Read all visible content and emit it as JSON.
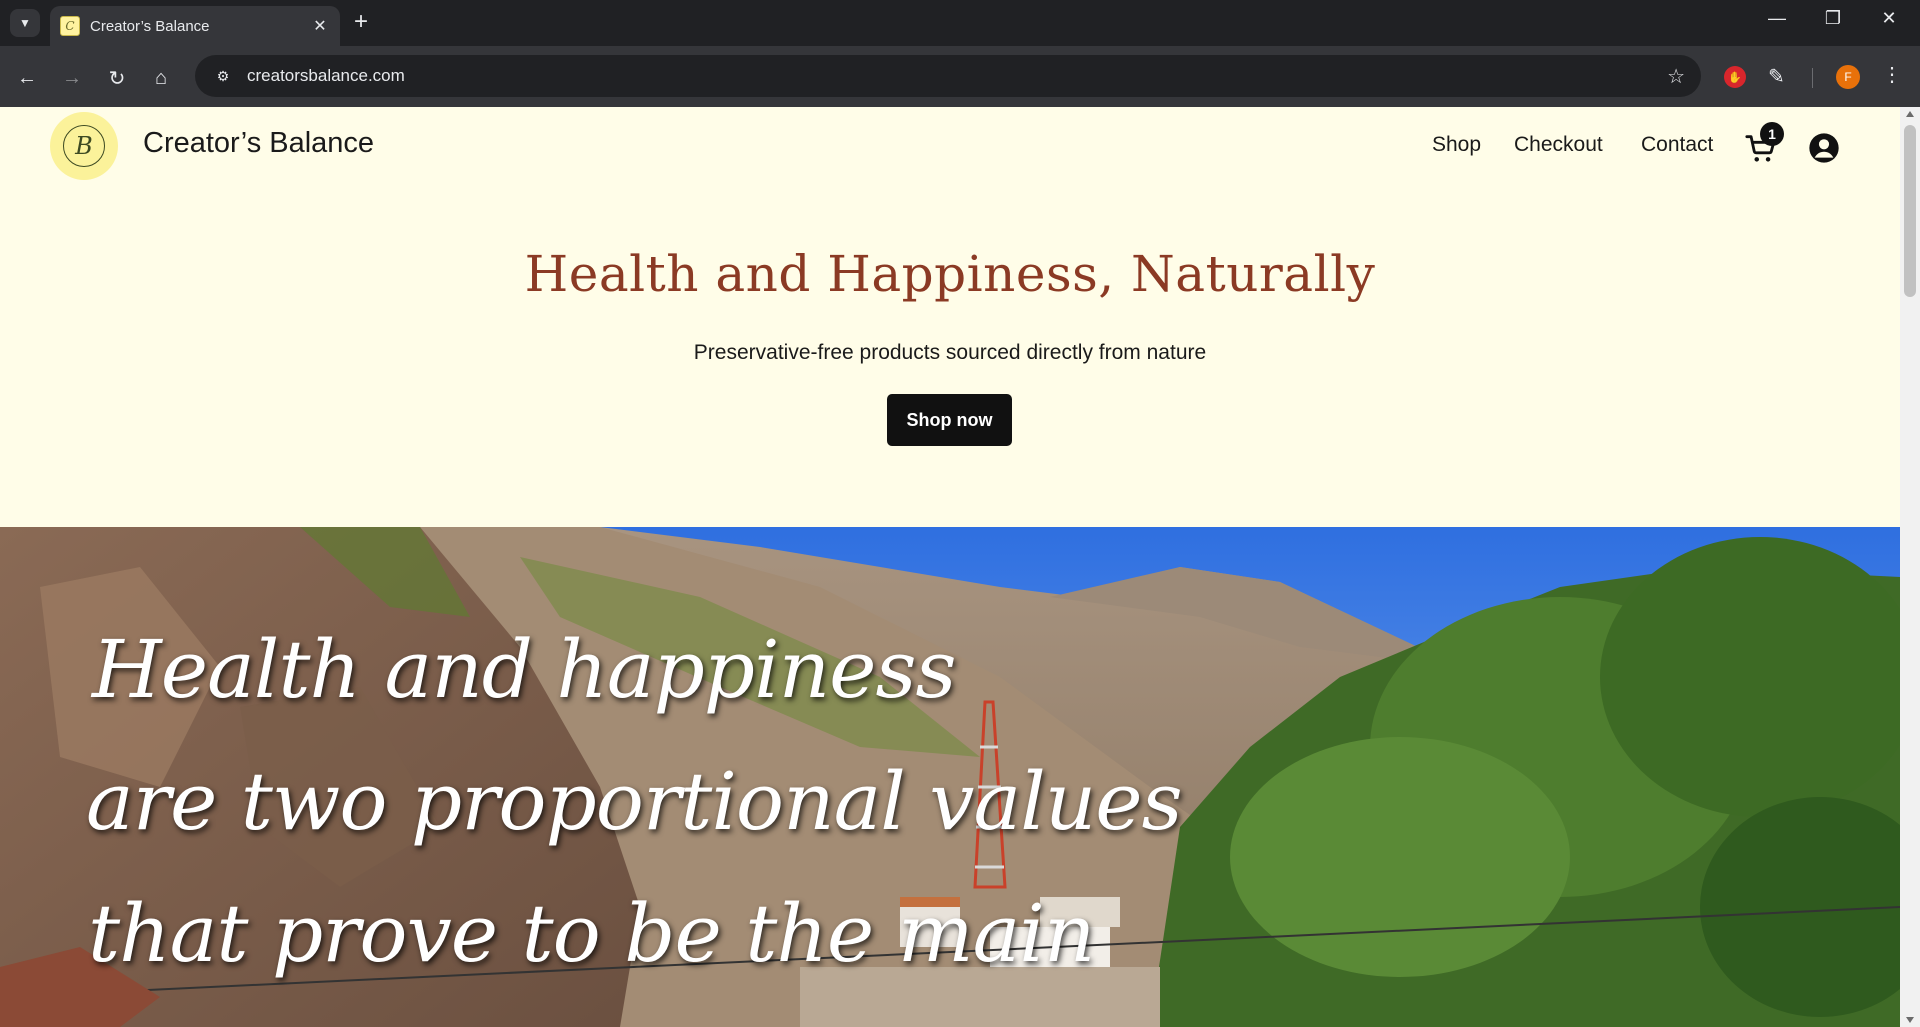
{
  "browser": {
    "tab_title": "Creator’s Balance",
    "url": "creatorsbalance.com",
    "profile_initial": "F"
  },
  "header": {
    "site_name": "Creator’s Balance",
    "nav": [
      "Shop",
      "Checkout",
      "Contact"
    ],
    "cart_count": "1"
  },
  "hero": {
    "title": "Health and Happiness, Naturally",
    "subtitle": "Preservative-free products sourced directly from nature",
    "cta": "Shop now"
  },
  "banner": {
    "quote_lines": [
      "Health and happiness",
      "are two proportional values",
      "that prove to be the main"
    ]
  },
  "colors": {
    "page_bg": "#fffde8",
    "title": "#8b3a24",
    "button": "#111111",
    "logo_bg": "#fbf29a"
  },
  "icons": [
    "tab-search-icon",
    "close-icon",
    "plus-icon",
    "back-icon",
    "forward-icon",
    "reload-icon",
    "home-icon",
    "site-info-icon",
    "star-icon",
    "extension-icon",
    "cart-icon",
    "account-icon"
  ]
}
